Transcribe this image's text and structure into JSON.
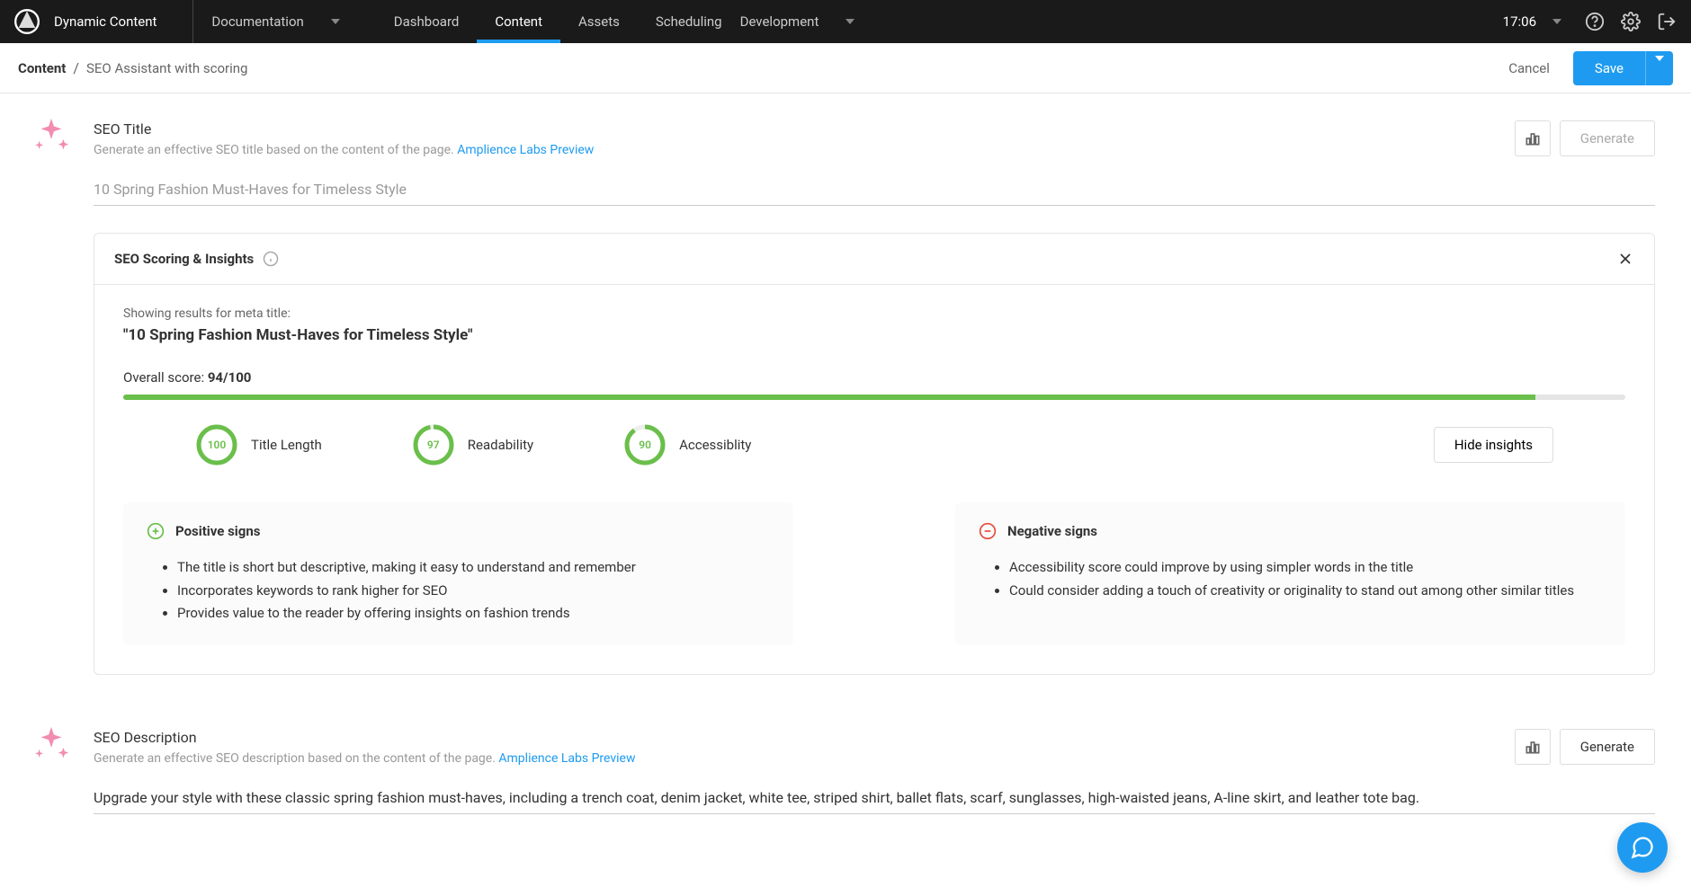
{
  "topbar": {
    "brand": "Dynamic Content",
    "dropdown1": "Documentation",
    "tabs": [
      "Dashboard",
      "Content",
      "Assets",
      "Scheduling"
    ],
    "active_tab": "Content",
    "dropdown2": "Development",
    "time": "17:06"
  },
  "breadcrumb": {
    "root": "Content",
    "leaf": "SEO Assistant with scoring",
    "cancel": "Cancel",
    "save": "Save"
  },
  "title_section": {
    "heading": "SEO Title",
    "sub": "Generate an effective SEO title based on the content of the page. ",
    "sub_link": "Amplience Labs Preview",
    "generate": "Generate",
    "value": "10 Spring Fashion Must-Haves for Timeless Style"
  },
  "insights": {
    "panel_title": "SEO Scoring & Insights",
    "results_label": "Showing results for meta title:",
    "meta_title": "\"10 Spring Fashion Must-Haves for Timeless Style\"",
    "overall_label": "Overall score: ",
    "overall_value": "94/100",
    "overall_pct": 94,
    "metrics": [
      {
        "score": 100,
        "label": "Title Length"
      },
      {
        "score": 97,
        "label": "Readability"
      },
      {
        "score": 90,
        "label": "Accessiblity"
      }
    ],
    "hide_button": "Hide insights",
    "positive": {
      "title": "Positive signs",
      "items": [
        "The title is short but descriptive, making it easy to understand and remember",
        "Incorporates keywords to rank higher for SEO",
        "Provides value to the reader by offering insights on fashion trends"
      ]
    },
    "negative": {
      "title": "Negative signs",
      "items": [
        "Accessibility score could improve by using simpler words in the title",
        "Could consider adding a touch of creativity or originality to stand out among other similar titles"
      ]
    }
  },
  "desc_section": {
    "heading": "SEO Description",
    "sub": "Generate an effective SEO description based on the content of the page. ",
    "sub_link": "Amplience Labs Preview",
    "generate": "Generate",
    "value": "Upgrade your style with these classic spring fashion must-haves, including a trench coat, denim jacket, white tee, striped shirt, ballet flats, scarf, sunglasses, high-waisted jeans, A-line skirt, and leather tote bag."
  },
  "colors": {
    "accent": "#1e9bf0",
    "green": "#6abf4b",
    "red": "#e74c3c"
  }
}
